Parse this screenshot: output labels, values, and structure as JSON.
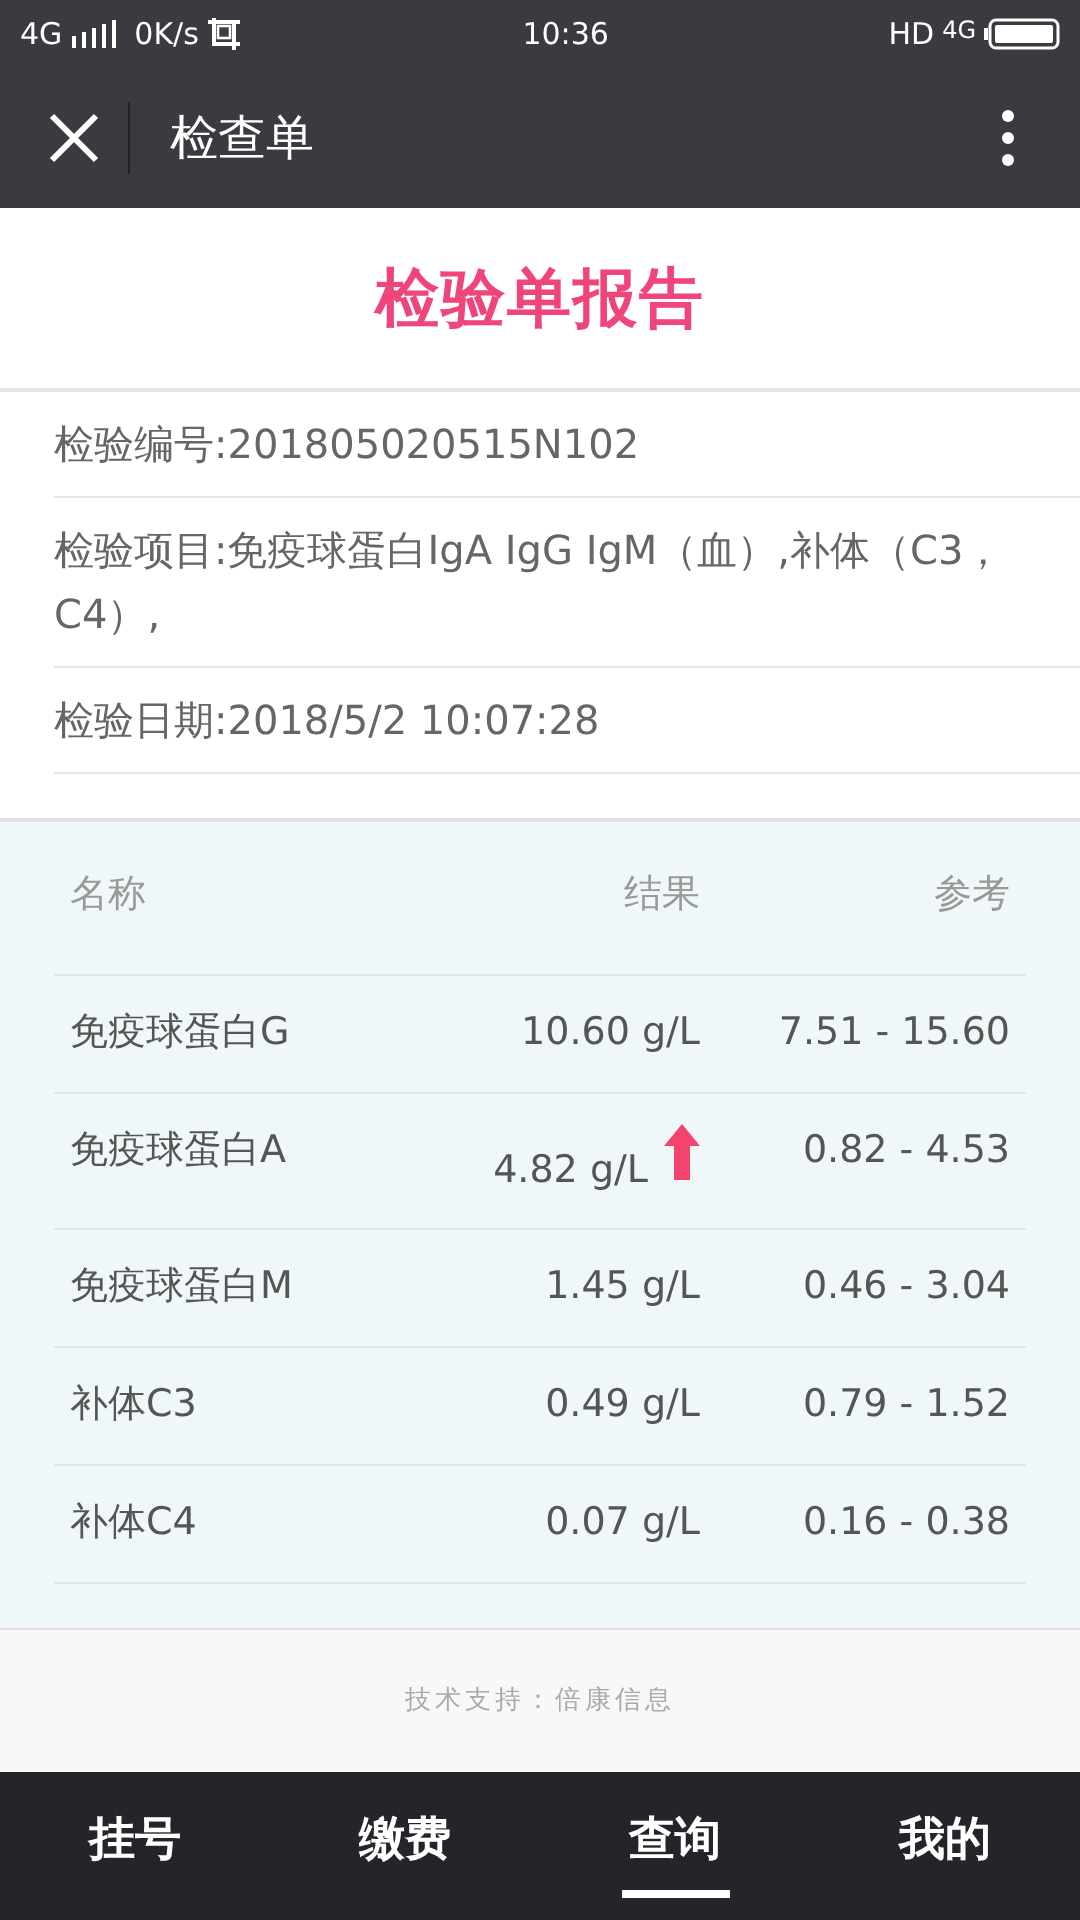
{
  "status_bar": {
    "network": "4G",
    "speed": "0K/s",
    "time": "10:36",
    "hd": "HD",
    "network_right": "4G"
  },
  "nav_bar": {
    "title": "检查单"
  },
  "report": {
    "heading": "检验单报告",
    "info": [
      {
        "label": "检验编号:",
        "value": "201805020515N102"
      },
      {
        "label": "检验项目:",
        "value": "免疫球蛋白IgA IgG IgM（血）,补体（C3，C4）,"
      },
      {
        "label": "检验日期:",
        "value": "2018/5/2 10:07:28"
      }
    ]
  },
  "table": {
    "columns": [
      "名称",
      "结果",
      "参考"
    ],
    "rows": [
      {
        "name": "免疫球蛋白G",
        "result": "10.60 g/L",
        "reference": "7.51 - 15.60",
        "high": false
      },
      {
        "name": "免疫球蛋白A",
        "result": "4.82 g/L",
        "reference": "0.82 - 4.53",
        "high": true
      },
      {
        "name": "免疫球蛋白M",
        "result": "1.45 g/L",
        "reference": "0.46 - 3.04",
        "high": false
      },
      {
        "name": "补体C3",
        "result": "0.49 g/L",
        "reference": "0.79 - 1.52",
        "high": false
      },
      {
        "name": "补体C4",
        "result": "0.07 g/L",
        "reference": "0.16 - 0.38",
        "high": false
      }
    ]
  },
  "footer": "技术支持：倍康信息",
  "tabs": [
    {
      "label": "挂号",
      "selected": false
    },
    {
      "label": "缴费",
      "selected": false
    },
    {
      "label": "查询",
      "selected": true
    },
    {
      "label": "我的",
      "selected": false
    }
  ]
}
